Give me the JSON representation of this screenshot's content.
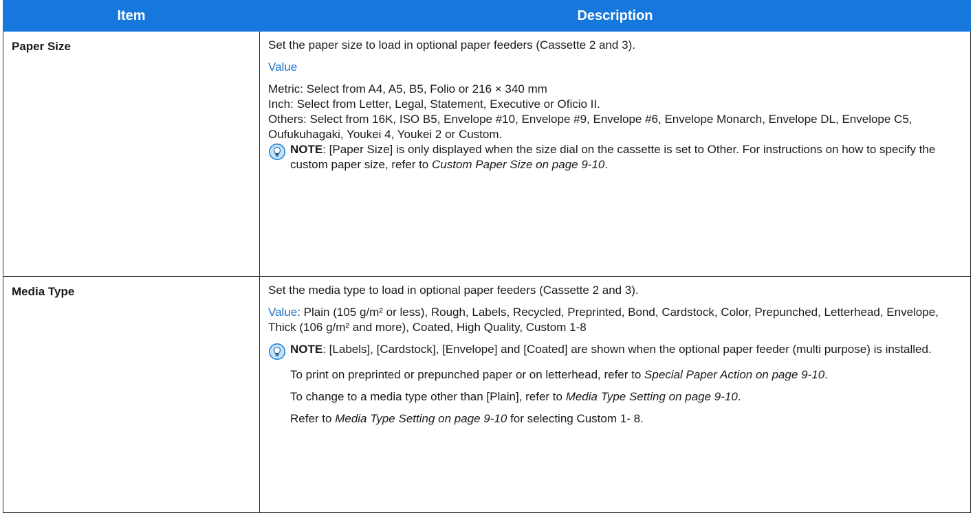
{
  "table": {
    "header_item": "Item",
    "header_description": "Description"
  },
  "paper_size": {
    "item": "Paper Size",
    "intro": "Set the paper size to load in optional paper feeders (Cassette 2 and 3).",
    "value_label": "Value",
    "metric": "Metric: Select from A4, A5, B5, Folio or 216 × 340 mm",
    "inch": "Inch: Select from Letter, Legal, Statement, Executive or Oficio II.",
    "others": "Others: Select from 16K, ISO B5, Envelope #10, Envelope #9, Envelope #6, Envelope Monarch, Envelope DL, Envelope C5, Oufukuhagaki, Youkei 4, Youkei 2 or Custom.",
    "note_label": "NOTE",
    "note_text": ": [Paper Size] is only displayed when the size dial on the cassette is set to Other. For instructions on how to specify the custom paper size, refer to ",
    "note_link": "Custom Paper Size on page 9-10",
    "note_end": "."
  },
  "media_type": {
    "item": "Media Type",
    "intro": "Set the media type to load in optional paper feeders (Cassette 2 and 3).",
    "value_label": "Value",
    "value_text": ": Plain (105 g/m² or less), Rough, Labels, Recycled, Preprinted, Bond, Cardstock, Color, Prepunched, Letterhead, Envelope, Thick (106 g/m² and more), Coated, High Quality, Custom 1-8",
    "note_label": "NOTE",
    "note_text": ": [Labels], [Cardstock], [Envelope] and [Coated] are shown when the optional paper feeder (multi purpose) is installed.",
    "line1_pre": "To print on preprinted or prepunched paper or on letterhead, refer to ",
    "line1_link": "Special Paper Action on page 9-10",
    "line1_end": ".",
    "line2_pre": "To change to a media type other than [Plain], refer to ",
    "line2_link": "Media Type Setting on page 9-10",
    "line2_end": ".",
    "line3_pre": "Refer to ",
    "line3_link": "Media Type Setting on page 9-10",
    "line3_end": " for selecting Custom 1- 8."
  }
}
